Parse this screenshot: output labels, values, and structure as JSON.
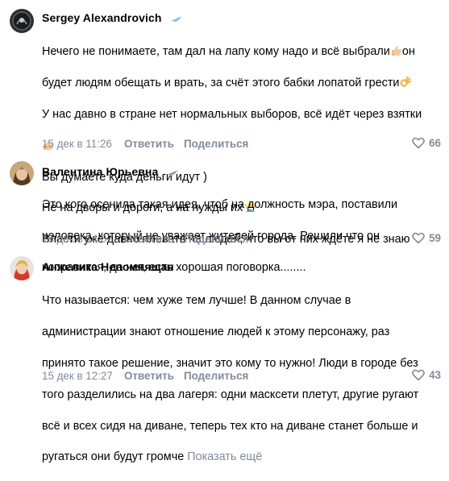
{
  "comments": [
    {
      "author": "Sergey Alexandrovich",
      "badge_icon": "light-blue-wing-badge-icon",
      "lines": [
        "Нечего не понимаете, там дал на лапу кому надо и всё выбрали",
        "он",
        "будет людям обещать и врать, за счёт этого бабки лопатой грести",
        "У нас давно в стране нет нормальных выборов, всё идёт через взятки",
        "Вы думаете куда деньги идут )",
        "Не на дворы и дороги, а на нужды их",
        "Власти уже давно плевать на людей, что вы от них ждёте я не знаю"
      ],
      "date": "15 дек в 11:26",
      "reply_label": "Ответить",
      "share_label": "Поделиться",
      "likes": "66"
    },
    {
      "author": "Валентина Юрьевна",
      "badge_icon": "grey-wing-badge-icon",
      "lines": [
        "Это кого осенила такая идея, чтоб на должность мэра, поставили",
        "человека, который не уважает жителей города. Решили что он",
        "исправится, да нет, есть хорошая поговорка........"
      ],
      "date": "15 дек в 14:07",
      "reply_label": "Ответить",
      "share_label": "Поделиться",
      "likes": "59"
    },
    {
      "author": "Анжелика Непомнящая",
      "lines": [
        "Что называется: чем хуже тем лучше! В данном случае в",
        "администрации знают отношение людей к этому персонажу, раз",
        "принято такое решение, значит это кому то нужно! Люди в городе без",
        "того разделились на два лагеря: одни масксети плетут, другие ругают",
        "всё и всех сидя на диване, теперь тех кто на диване станет больше и",
        "ругаться они будут громче"
      ],
      "show_more": "Показать ещё",
      "date": "15 дек в 12:27",
      "reply_label": "Ответить",
      "share_label": "Поделиться",
      "likes": "43"
    }
  ],
  "colors": {
    "meta": "#818c99",
    "text": "#000000"
  }
}
